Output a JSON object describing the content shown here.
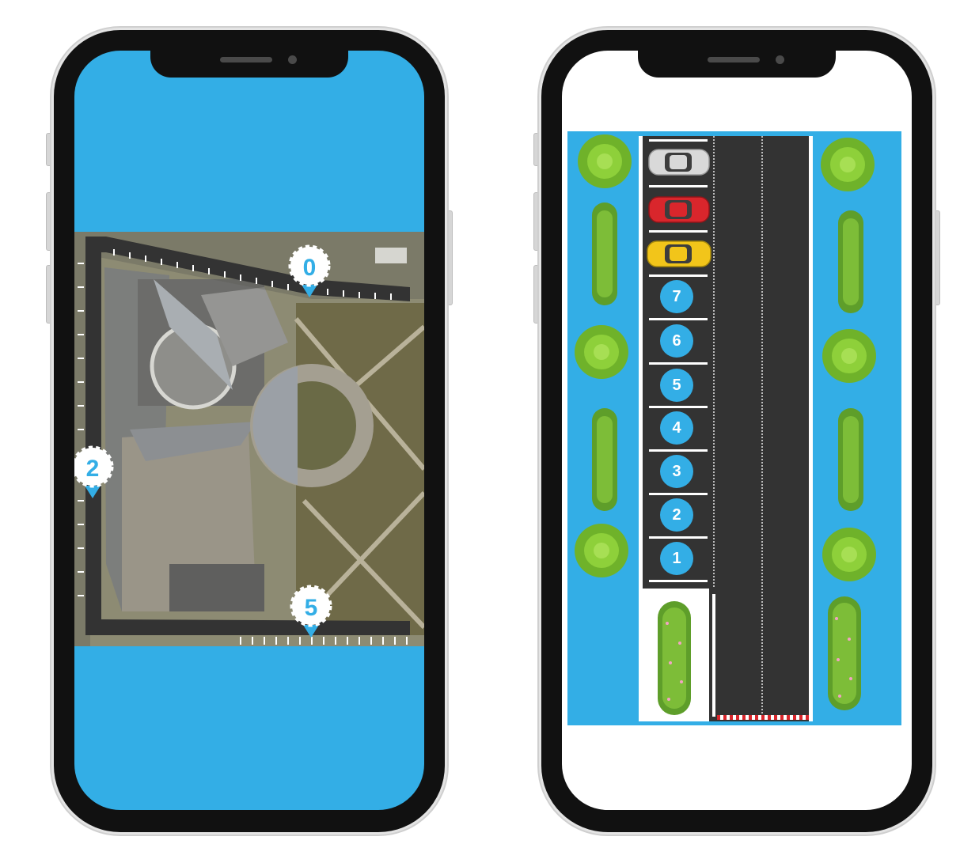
{
  "colors": {
    "accent": "#33aee6",
    "road": "#333333",
    "grass": "#7dc22e",
    "car_white": "#d9d9d9",
    "car_red": "#d9262c",
    "car_yellow": "#f2c51a"
  },
  "left_phone": {
    "pins": [
      {
        "label": "0"
      },
      {
        "label": "2"
      },
      {
        "label": "5"
      }
    ]
  },
  "right_phone": {
    "spots": [
      {
        "label": "7"
      },
      {
        "label": "6"
      },
      {
        "label": "5"
      },
      {
        "label": "4"
      },
      {
        "label": "3"
      },
      {
        "label": "2"
      },
      {
        "label": "1"
      }
    ],
    "cars": [
      {
        "color": "white"
      },
      {
        "color": "red"
      },
      {
        "color": "yellow"
      }
    ]
  }
}
